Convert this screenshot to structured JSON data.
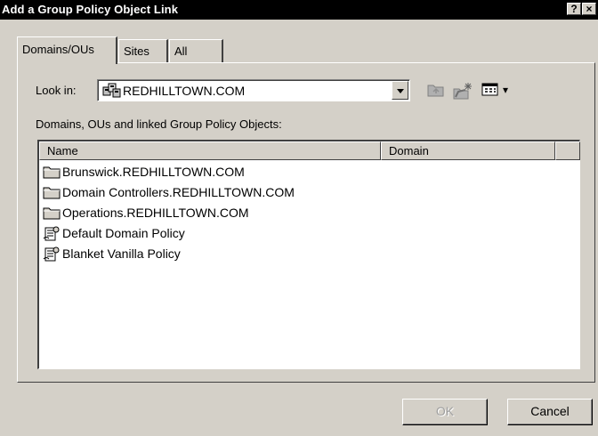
{
  "window": {
    "title": "Add a Group Policy Object Link",
    "help_glyph": "?",
    "close_glyph": "×"
  },
  "tabs": [
    {
      "label": "Domains/OUs",
      "active": true
    },
    {
      "label": "Sites",
      "active": false
    },
    {
      "label": "All",
      "active": false
    }
  ],
  "look_in": {
    "label": "Look in:",
    "value": "REDHILLTOWN.COM",
    "icon": "domain-icon"
  },
  "toolbar": {
    "icons": [
      "up-folder-icon",
      "new-ou-gpo-icon",
      "view-menu-icon"
    ],
    "view_menu_arrow": "▾"
  },
  "list": {
    "caption": "Domains, OUs and linked Group Policy Objects:",
    "columns": [
      "Name",
      "Domain"
    ],
    "items": [
      {
        "name": "Brunswick.REDHILLTOWN.COM",
        "icon": "folder-icon"
      },
      {
        "name": "Domain Controllers.REDHILLTOWN.COM",
        "icon": "folder-icon"
      },
      {
        "name": "Operations.REDHILLTOWN.COM",
        "icon": "folder-icon"
      },
      {
        "name": "Default Domain Policy",
        "icon": "gpo-icon"
      },
      {
        "name": "Blanket Vanilla Policy",
        "icon": "gpo-icon"
      }
    ]
  },
  "buttons": {
    "ok": "OK",
    "cancel": "Cancel"
  }
}
